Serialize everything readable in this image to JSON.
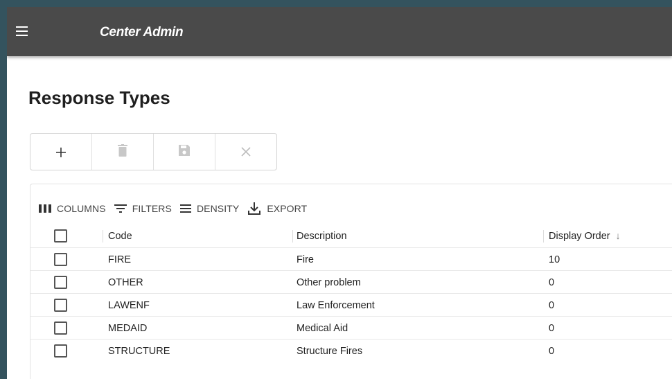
{
  "app": {
    "title": "Center Admin"
  },
  "page": {
    "title": "Response Types"
  },
  "toolbar": {
    "buttons": [
      {
        "name": "add",
        "glyph": "+"
      },
      {
        "name": "delete",
        "glyph": ""
      },
      {
        "name": "save",
        "glyph": ""
      },
      {
        "name": "cancel",
        "glyph": "×"
      }
    ]
  },
  "grid_toolbar": {
    "columns_label": "COLUMNS",
    "filters_label": "FILTERS",
    "density_label": "DENSITY",
    "export_label": "EXPORT"
  },
  "table": {
    "headers": {
      "code": "Code",
      "description": "Description",
      "display_order": "Display Order"
    },
    "sort_glyph": "↓",
    "rows": [
      {
        "code": "FIRE",
        "description": "Fire",
        "display_order": "10"
      },
      {
        "code": "OTHER",
        "description": "Other problem",
        "display_order": "0"
      },
      {
        "code": "LAWENF",
        "description": "Law Enforcement",
        "display_order": "0"
      },
      {
        "code": "MEDAID",
        "description": "Medical Aid",
        "display_order": "0"
      },
      {
        "code": "STRUCTURE",
        "description": "Structure Fires",
        "display_order": "0"
      }
    ]
  },
  "colors": {
    "appbar": "#4a4a4a",
    "frame": "#34535e"
  }
}
